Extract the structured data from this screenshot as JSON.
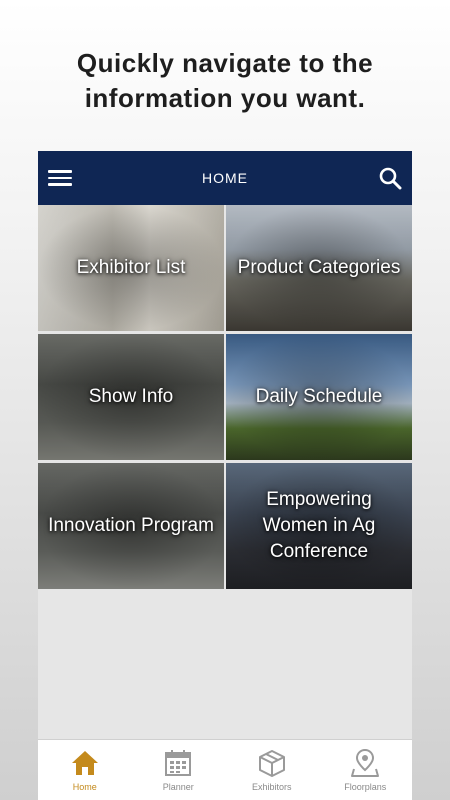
{
  "promo": {
    "line1": "Quickly navigate to the",
    "line2": "information you want."
  },
  "appbar": {
    "title": "HOME",
    "color": "#0f2654"
  },
  "tiles": [
    {
      "label": "Exhibitor List"
    },
    {
      "label": "Product Categories"
    },
    {
      "label": "Show Info"
    },
    {
      "label": "Daily Schedule"
    },
    {
      "label": "Innovation Program"
    },
    {
      "label": "Empowering Women in Ag Conference"
    }
  ],
  "tabs": [
    {
      "label": "Home",
      "icon": "home-icon",
      "active": true
    },
    {
      "label": "Planner",
      "icon": "calendar-icon"
    },
    {
      "label": "Exhibitors",
      "icon": "box-icon"
    },
    {
      "label": "Floorplans",
      "icon": "map-pin-icon"
    }
  ],
  "colors": {
    "active_tab": "#c48a1c",
    "inactive_tab": "#8a8a8a"
  }
}
